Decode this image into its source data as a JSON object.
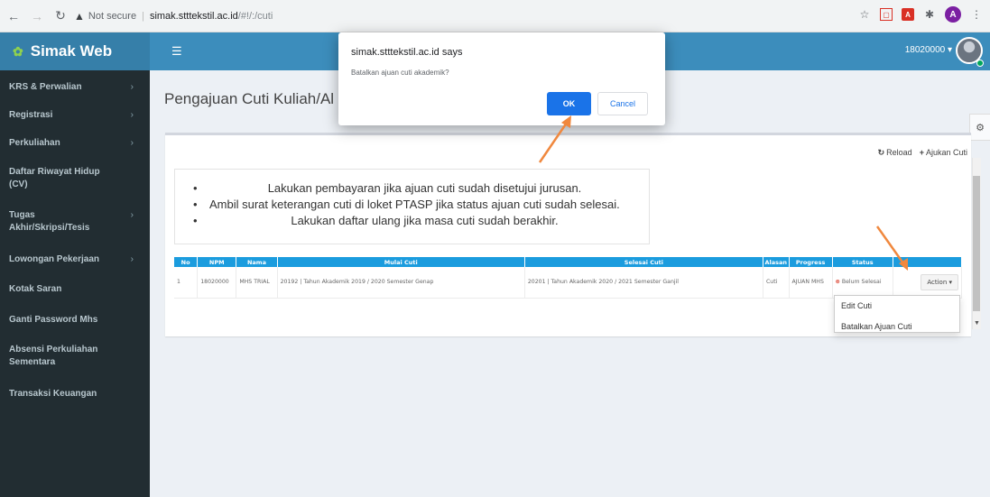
{
  "browser": {
    "security_text": "Not secure",
    "host": "simak.stttekstil.ac.id",
    "path": "/#!/:/cuti"
  },
  "app": {
    "logo": "Simak Web",
    "user": "18020000 ▾"
  },
  "sidebar": {
    "items": [
      {
        "label": "KRS & Perwalian"
      },
      {
        "label": "Registrasi"
      },
      {
        "label": "Perkuliahan"
      },
      {
        "label": "Daftar Riwayat Hidup"
      },
      {
        "label": "(CV)"
      },
      {
        "label": "Tugas"
      },
      {
        "label": "Akhir/Skripsi/Tesis"
      },
      {
        "label": "Lowongan Pekerjaan"
      },
      {
        "label": "Kotak Saran"
      },
      {
        "label": "Ganti Password Mhs"
      },
      {
        "label": "Absensi Perkuliahan"
      },
      {
        "label": "Sementara"
      },
      {
        "label": "Transaksi Keuangan"
      }
    ]
  },
  "page": {
    "title": "Pengajuan Cuti Kuliah/Al",
    "reload": "Reload",
    "ajukan": "Ajukan Cuti"
  },
  "info": [
    "Lakukan pembayaran jika ajuan cuti sudah disetujui jurusan.",
    "Ambil surat keterangan cuti di loket PTASP jika status ajuan cuti sudah selesai.",
    "Lakukan daftar ulang jika masa cuti sudah berakhir."
  ],
  "table": {
    "headers": [
      "No",
      "NPM",
      "Nama",
      "Mulai Cuti",
      "Selesai Cuti",
      "Alasan",
      "Progress",
      "Status",
      ""
    ],
    "row": {
      "no": "1",
      "npm": "18020000",
      "nama": "MHS TRIAL",
      "mulai": "20192 | Tahun Akademik 2019 / 2020 Semester Genap",
      "selesai": "20201 | Tahun Akademik 2020 / 2021 Semester Ganjil",
      "alasan": "Cuti",
      "progress": "AJUAN MHS",
      "status": "Belum Selesai",
      "action": "Action ▾"
    }
  },
  "dropdown": {
    "edit": "Edit Cuti",
    "batalkan": "Batalkan Ajuan Cuti"
  },
  "dialog": {
    "title": "simak.stttekstil.ac.id says",
    "message": "Batalkan ajuan cuti akademik?",
    "ok": "OK",
    "cancel": "Cancel"
  },
  "colors": {
    "header": "#3c8dbc",
    "sidebar": "#222d32",
    "table_header": "#1b9cde",
    "arrow": "#f0883e"
  }
}
